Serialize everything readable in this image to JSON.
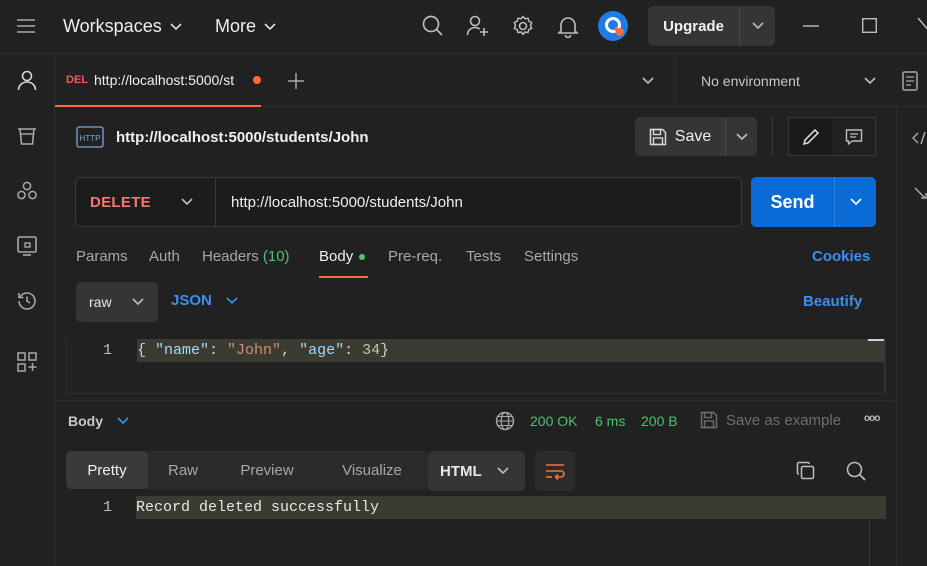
{
  "topbar": {
    "workspaces_label": "Workspaces",
    "more_label": "More",
    "upgrade_label": "Upgrade",
    "brand_color": "#ff6c37"
  },
  "tab": {
    "method_tag": "DEL",
    "url": "http://localhost:5000/st"
  },
  "environment": {
    "selected": "No environment"
  },
  "request": {
    "icon_text": "HTTP",
    "title": "http://localhost:5000/students/John",
    "save_label": "Save",
    "method": "DELETE",
    "url": "http://localhost:5000/students/John",
    "send_label": "Send",
    "send_color": "#0b6bd6"
  },
  "request_tabs": {
    "params": "Params",
    "auth": "Auth",
    "headers": "Headers",
    "headers_count": "(10)",
    "body": "Body",
    "prereq": "Pre-req.",
    "tests": "Tests",
    "settings": "Settings",
    "cookies": "Cookies"
  },
  "body_options": {
    "mode": "raw",
    "language": "JSON",
    "beautify": "Beautify"
  },
  "editor": {
    "line_number": "1",
    "code": {
      "open": "{ ",
      "key1": "\"name\"",
      "colon1": ": ",
      "val1": "\"John\"",
      "comma": ", ",
      "key2": "\"age\"",
      "colon2": ": ",
      "val2": "34",
      "close": "}"
    }
  },
  "response": {
    "body_label": "Body",
    "status": "200 OK",
    "time": "6 ms",
    "size": "200 B",
    "save_example": "Save as example",
    "more": "ooo",
    "tabs": [
      "Pretty",
      "Raw",
      "Preview",
      "Visualize"
    ],
    "format": "HTML",
    "line_number": "1",
    "text": "Record deleted successfully"
  }
}
